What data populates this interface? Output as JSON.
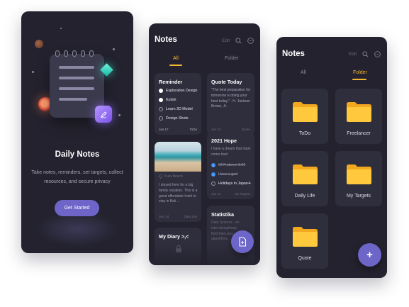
{
  "colors": {
    "background": "#ffffff",
    "phone_bg": "#23222e",
    "card_bg": "#2f2e3d",
    "accent_yellow": "#f5b82e",
    "button_purple": "#6d66c8",
    "check_blue": "#3d8ef0",
    "folder_yellow": "#ffc83d"
  },
  "onboarding": {
    "title": "Daily Notes",
    "description": "Take notes, reminders, set targets, collect resources, and secure privacy",
    "cta_label": "Get Started",
    "icons": [
      "notepad-icon",
      "edit-icon",
      "diamond-icon",
      "planet-icon"
    ]
  },
  "notes_screen": {
    "title": "Notes",
    "edit_label": "Edit",
    "tabs": [
      {
        "label": "All",
        "active": true
      },
      {
        "label": "Folder",
        "active": false
      }
    ],
    "cards": {
      "reminder": {
        "title": "Reminder",
        "items": [
          {
            "text": "Exploration Design",
            "checked": true
          },
          {
            "text": "Kulish",
            "checked": true
          },
          {
            "text": "Learn 3D Model",
            "checked": false
          },
          {
            "text": "Design Shots",
            "checked": false
          }
        ],
        "date": "Jan 17",
        "tag": "ToDo"
      },
      "quote": {
        "title": "Quote Today",
        "text": "\"The best preparation for tomorrow is doing your best today.\" - H. Jackson Brown, Jr.",
        "date": "Jan 22",
        "tag": "Quote"
      },
      "bali": {
        "location": "Kuta Beach",
        "text": "I stayed here for a big family vacation. This is a great affordable hotel to stay in Bali ...",
        "date": "Dec 24",
        "tag": "Daily Life"
      },
      "hope": {
        "title": "2021 Hope",
        "text": "I have a dream that must come true!",
        "items": [
          {
            "text": "GPA above 3.60",
            "checked": true,
            "strikethrough": true
          },
          {
            "text": "Have a god",
            "checked": true,
            "strikethrough": true
          },
          {
            "text": "Holidays in Japan✈",
            "checked": false,
            "strikethrough": false
          }
        ],
        "date": "Jan 21",
        "tag": "My Targets"
      },
      "diary": {
        "title": "My Diary >,<"
      },
      "statistika": {
        "title": "Statistika",
        "text": "Data Science - an inter-disciplinary field that uses algorithms ..."
      }
    }
  },
  "folders_screen": {
    "title": "Notes",
    "edit_label": "Edit",
    "tabs": [
      {
        "label": "All",
        "active": false
      },
      {
        "label": "Folder",
        "active": true
      }
    ],
    "folders": [
      {
        "label": "ToDo"
      },
      {
        "label": "Freelancer"
      },
      {
        "label": "Daily Life"
      },
      {
        "label": "My Targets"
      },
      {
        "label": "Quote"
      }
    ],
    "fab_label": "+"
  }
}
